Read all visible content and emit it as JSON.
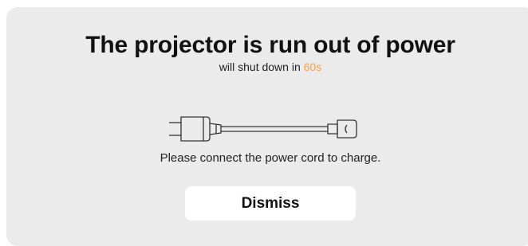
{
  "dialog": {
    "title": "The projector is run out of power",
    "subtitle_prefix": "will shut down in ",
    "countdown": "60s",
    "prompt": "Please connect the power cord to charge.",
    "dismiss_label": "Dismiss",
    "icon": "power-cord-icon"
  },
  "colors": {
    "background": "#ebebeb",
    "countdown_accent": "#f5a04a",
    "button_bg": "#ffffff",
    "text": "#111111"
  }
}
